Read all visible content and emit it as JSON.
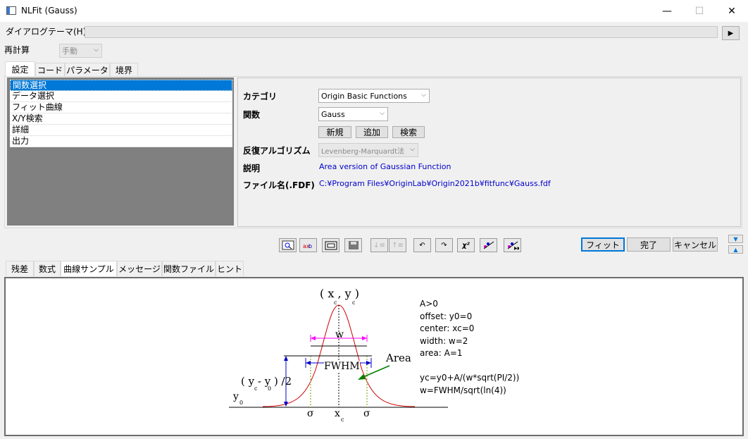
{
  "window": {
    "title": "NLFit (Gauss)",
    "minimize": "—",
    "maximize": "☐",
    "close": "✕"
  },
  "theme": {
    "label": "ダイアログテーマ(H)",
    "play": "▶"
  },
  "recalc": {
    "label": "再計算",
    "value": "手動"
  },
  "top_tabs": [
    "設定",
    "コード",
    "パラメータ",
    "境界"
  ],
  "tree": [
    "関数選択",
    "データ選択",
    "フィット曲線",
    "X/Y検索",
    "詳細",
    "出力"
  ],
  "settings": {
    "category_label": "カテゴリ",
    "category_value": "Origin Basic Functions",
    "function_label": "関数",
    "function_value": "Gauss",
    "new_btn": "新規",
    "add_btn": "追加",
    "search_btn": "検索",
    "algo_label": "反復アルゴリズム",
    "algo_value": "Levenberg-Marquardt法",
    "desc_label": "説明",
    "desc_value": "Area version of Gaussian Function",
    "file_label": "ファイル名(.FDF)",
    "file_value": "C:¥Program Files¥OriginLab¥Origin2021b¥fitfunc¥Gauss.fdf"
  },
  "action_buttons": {
    "fit": "フィット",
    "done": "完了",
    "cancel": "キャンセル"
  },
  "bottom_tabs": [
    "残差",
    "数式",
    "曲線サンプル",
    "メッセージ",
    "関数ファイル",
    "ヒント"
  ],
  "sample": {
    "notes": [
      "A>0",
      "offset: y0=0",
      "center: xc=0",
      "width: w=2",
      "area: A=1",
      "",
      "yc=y0+A/(w*sqrt(PI/2))",
      "w=FWHM/sqrt(ln(4))"
    ],
    "peak_label": "( x , y )",
    "peak_sub_c1": "c",
    "peak_sub_c2": "c",
    "w_label": "w",
    "fwhm_label": "FWHM",
    "area_label": "Area",
    "half_label": "( y - y ) /2",
    "half_sub_c": "c",
    "half_sub_0": "0",
    "y0_label": "y",
    "y0_sub": "0",
    "sigma_left": "σ",
    "sigma_right": "σ",
    "xc_label": "x",
    "xc_sub": "c"
  },
  "colors": {
    "accent": "#0078d7",
    "curve": "#cc0000",
    "w_marker": "#ff00ff",
    "fwhm_marker": "#0000cc",
    "area_arrow": "#008000",
    "guide": "#70a000"
  }
}
